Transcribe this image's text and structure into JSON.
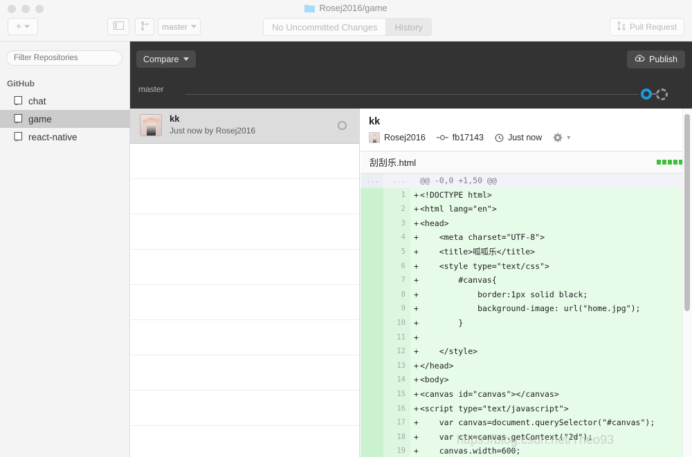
{
  "window": {
    "title": "Rosej2016/game",
    "folder_icon": "folder-icon",
    "traffic_lights": [
      "close",
      "minimize",
      "maximize"
    ]
  },
  "toolbar": {
    "add_label": "+",
    "add_caret": "⌄",
    "sidebar_toggle_icon": "panel-icon",
    "branch_icon": "new-branch-icon",
    "branch_name": "master",
    "branch_caret": "⌄",
    "segments": [
      {
        "label": "No Uncommitted Changes",
        "selected": false
      },
      {
        "label": "History",
        "selected": true
      }
    ],
    "pull_request_label": "Pull Request",
    "pull_request_icon": "pull-request-icon"
  },
  "sidebar": {
    "filter_placeholder": "Filter Repositories",
    "filter_value": "",
    "group_label": "GitHub",
    "repos": [
      {
        "name": "chat",
        "active": false
      },
      {
        "name": "game",
        "active": true
      },
      {
        "name": "react-native",
        "active": false
      }
    ]
  },
  "repo_header": {
    "compare_label": "Compare",
    "publish_label": "Publish",
    "publish_icon": "publish-cloud-icon",
    "branch_label": "master"
  },
  "commit_list": {
    "commits": [
      {
        "title": "kk",
        "meta": "Just now by Rosej2016",
        "selected": true
      }
    ],
    "empty_rows": 10
  },
  "detail": {
    "title": "kk",
    "author": "Rosej2016",
    "sha": "fb17143",
    "time": "Just now",
    "commit_icon": "commit-dot-icon",
    "clock_icon": "clock-icon",
    "gear_icon": "gear-icon",
    "gear_caret": "▾",
    "file": {
      "name": "刮刮乐.html",
      "blocks": 5,
      "block_color": "#3ec03e"
    },
    "diff": {
      "hunk_header": "@@ -0,0 +1,50 @@",
      "lines": [
        {
          "num": "1",
          "sign": "+",
          "code": "<!DOCTYPE html>"
        },
        {
          "num": "2",
          "sign": "+",
          "code": "<html lang=\"en\">"
        },
        {
          "num": "3",
          "sign": "+",
          "code": "<head>"
        },
        {
          "num": "4",
          "sign": "+",
          "code": "    <meta charset=\"UTF-8\">"
        },
        {
          "num": "5",
          "sign": "+",
          "code": "    <title>呱呱乐</title>"
        },
        {
          "num": "6",
          "sign": "+",
          "code": "    <style type=\"text/css\">"
        },
        {
          "num": "7",
          "sign": "+",
          "code": "        #canvas{"
        },
        {
          "num": "8",
          "sign": "+",
          "code": "            border:1px solid black;"
        },
        {
          "num": "9",
          "sign": "+",
          "code": "            background-image: url(\"home.jpg\");"
        },
        {
          "num": "10",
          "sign": "+",
          "code": "        }"
        },
        {
          "num": "11",
          "sign": "+",
          "code": ""
        },
        {
          "num": "12",
          "sign": "+",
          "code": "    </style>"
        },
        {
          "num": "13",
          "sign": "+",
          "code": "</head>"
        },
        {
          "num": "14",
          "sign": "+",
          "code": "<body>"
        },
        {
          "num": "15",
          "sign": "+",
          "code": "<canvas id=\"canvas\"></canvas>"
        },
        {
          "num": "16",
          "sign": "+",
          "code": "<script type=\"text/javascript\">"
        },
        {
          "num": "17",
          "sign": "+",
          "code": "    var canvas=document.querySelector(\"#canvas\");"
        },
        {
          "num": "18",
          "sign": "+",
          "code": "    var ctx=canvas.getContext(\"2d\");"
        },
        {
          "num": "19",
          "sign": "+",
          "code": "    canvas.width=600;"
        }
      ]
    }
  },
  "watermark": "https://blog.csdn.net/Theo93"
}
